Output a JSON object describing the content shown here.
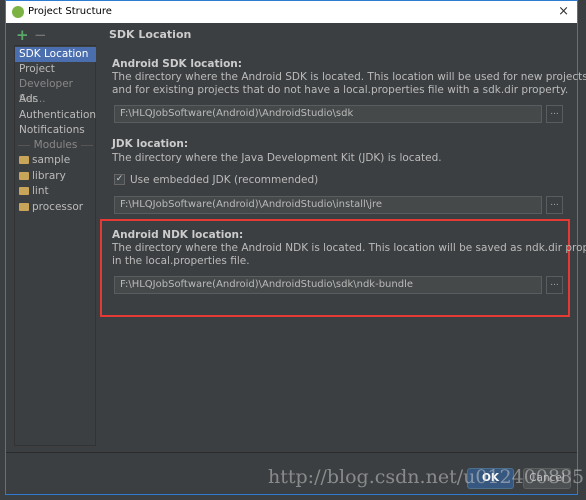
{
  "window": {
    "title": "Project Structure",
    "close_icon": "×"
  },
  "sidebar": {
    "add": "+",
    "remove": "−",
    "items": [
      {
        "label": "SDK Location",
        "selected": true
      },
      {
        "label": "Project"
      },
      {
        "label": "Developer Ser...",
        "group": true
      },
      {
        "label": "Ads"
      },
      {
        "label": "Authentication"
      },
      {
        "label": "Notifications"
      },
      {
        "label": "Modules",
        "group": true
      },
      {
        "label": "sample"
      },
      {
        "label": "library"
      },
      {
        "label": "lint"
      },
      {
        "label": "processor"
      }
    ]
  },
  "main": {
    "title": "SDK Location",
    "sdk": {
      "label": "Android SDK location:",
      "desc1": "The directory where the Android SDK is located. This location will be used for new projects,",
      "desc2": "and for existing projects that do not have a local.properties file with a sdk.dir property.",
      "value": "F:\\HLQJobSoftware(Android)\\AndroidStudio\\sdk"
    },
    "jdk": {
      "label": "JDK location:",
      "desc": "The directory where the Java Development Kit (JDK) is located.",
      "checkbox": "Use embedded JDK (recommended)",
      "checked": true,
      "value": "F:\\HLQJobSoftware(Android)\\AndroidStudio\\install\\jre"
    },
    "ndk": {
      "label": "Android NDK location:",
      "desc1": "The directory where the Android NDK is located. This location will be saved as ndk.dir property",
      "desc2": "in the local.properties file.",
      "value": "F:\\HLQJobSoftware(Android)\\AndroidStudio\\sdk\\ndk-bundle"
    },
    "browse": "..."
  },
  "footer": {
    "ok": "OK",
    "cancel": "Cancel"
  },
  "watermark": "http://blog.csdn.net/u012400885",
  "colors": {
    "selection": "#4b6eaf",
    "highlight_box": "#e53935",
    "add": "#59a869"
  }
}
